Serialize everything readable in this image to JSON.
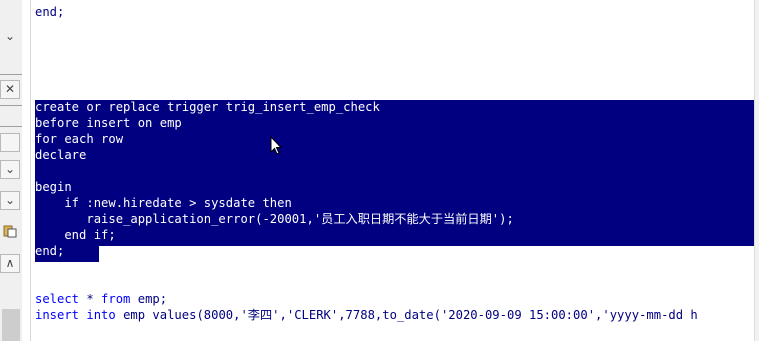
{
  "left_panel": {
    "chevron_glyph": "⌄",
    "close_glyph": "✕",
    "up_glyph": "∧"
  },
  "editor": {
    "lines": [
      {
        "text": "end;",
        "selected": false
      },
      {
        "text": "create or replace trigger trig_insert_emp_check",
        "selected": true
      },
      {
        "text": "before insert on emp",
        "selected": true
      },
      {
        "text": "for each row",
        "selected": true
      },
      {
        "text": "declare",
        "selected": true
      },
      {
        "text": "",
        "selected": true
      },
      {
        "text": "begin",
        "selected": true
      },
      {
        "text": "    if :new.hiredate > sysdate then",
        "selected": true
      },
      {
        "text": "       raise_application_error(-20001,'员工入职日期不能大于当前日期');",
        "selected": true
      },
      {
        "text": "    end if;",
        "selected": true
      },
      {
        "text": "end;",
        "selected": true
      }
    ],
    "query_line": {
      "kw1": "select",
      "mid": " * ",
      "kw2": "from",
      "rest": " emp;"
    },
    "insert_line": {
      "kw1": "insert",
      "mid": " ",
      "kw2": "into",
      "rest": " emp values(8000,'李四','CLERK',7788,to_date('2020-09-09 15:00:00','yyyy-mm-dd h"
    }
  },
  "icons": [
    "chevron-down-icon",
    "close-icon",
    "dropdown-arrow-icon",
    "paste-icon",
    "scroll-up-icon",
    "mouse-pointer-icon"
  ]
}
